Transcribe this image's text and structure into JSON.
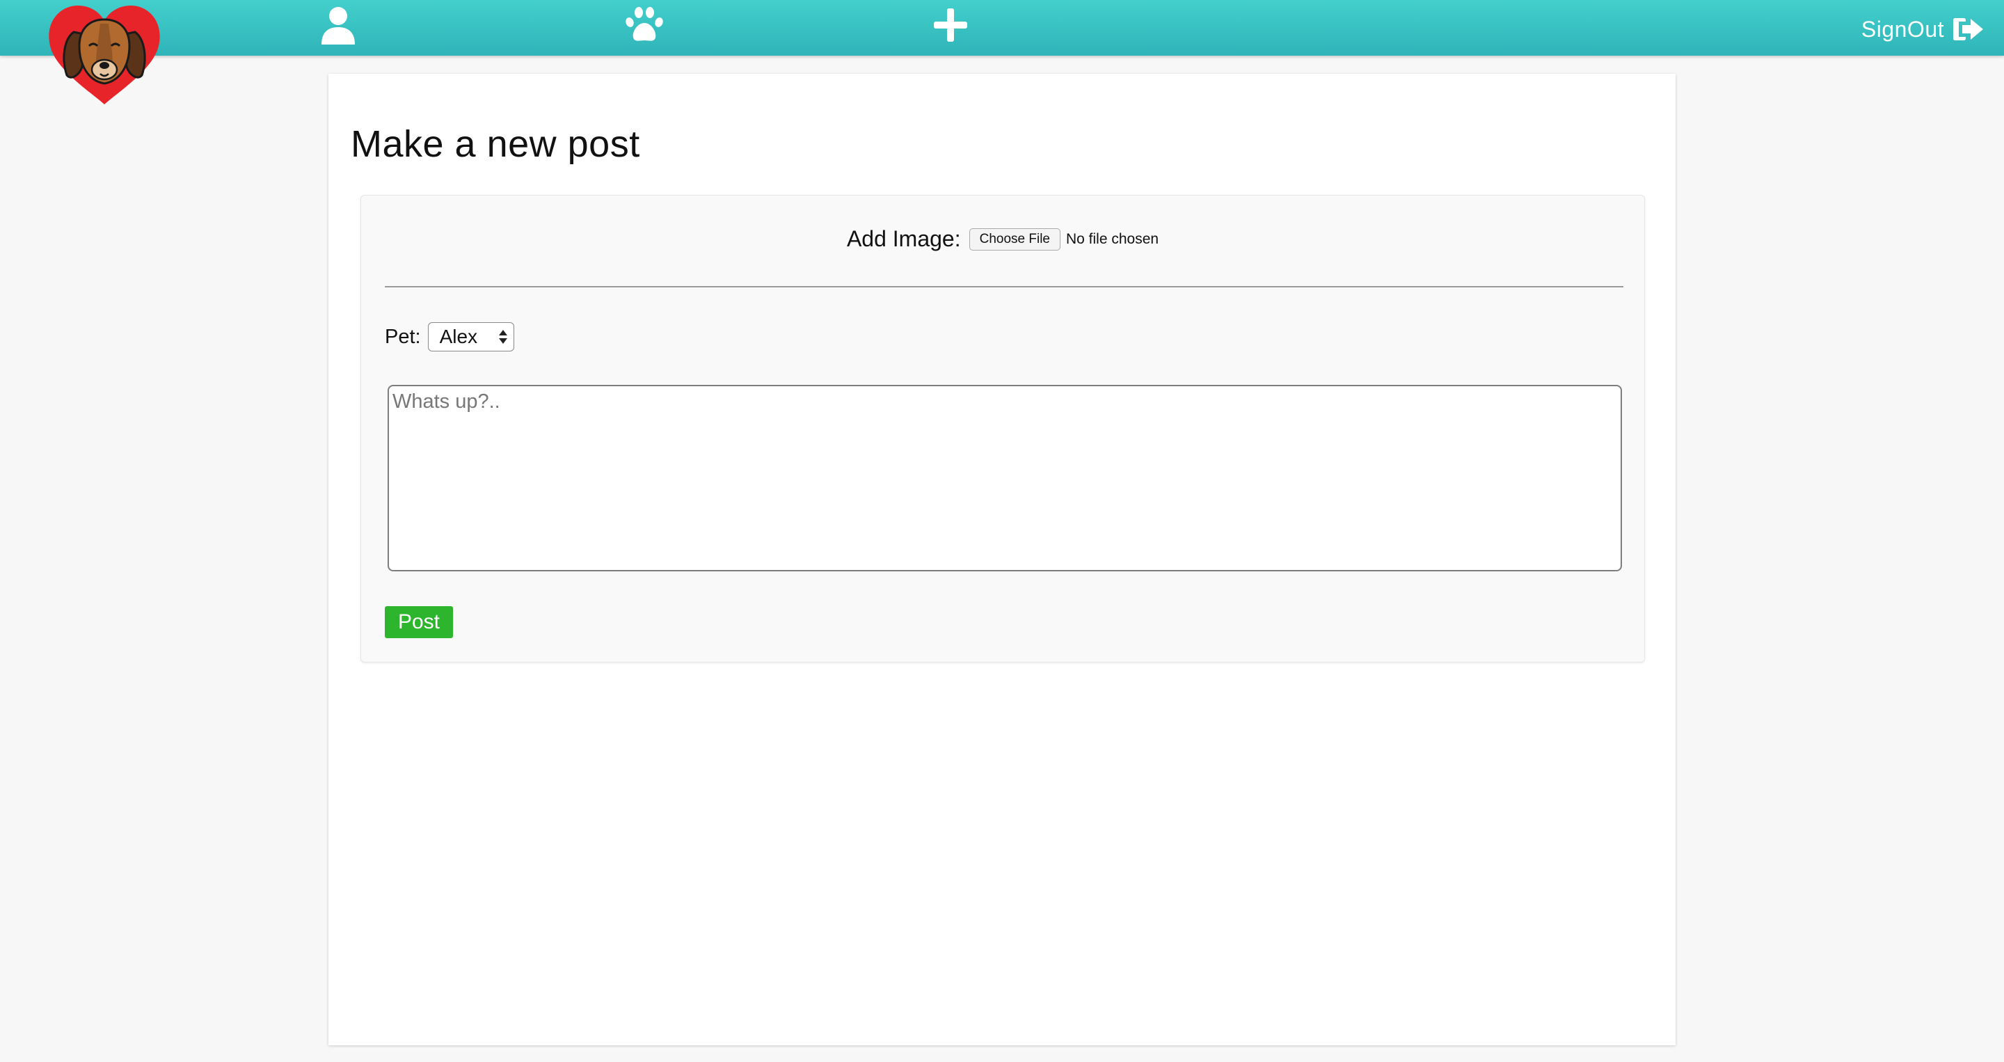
{
  "navbar": {
    "icons": {
      "logo": "dog-heart-logo",
      "profile": "user-icon",
      "pets": "paw-icon",
      "add": "plus-icon",
      "signout": "sign-out-icon"
    },
    "signout_label": "SignOut",
    "colors": {
      "bar_top": "#43cfcc",
      "bar_bottom": "#2fb4b8",
      "logo_heart": "#e8242b"
    }
  },
  "main": {
    "title": "Make a new post",
    "form": {
      "image_label": "Add Image:",
      "choose_file_label": "Choose File",
      "file_status": "No file chosen",
      "pet_label": "Pet:",
      "pet_selected": "Alex",
      "textarea_placeholder": "Whats up?..",
      "textarea_value": "",
      "post_button_label": "Post",
      "post_button_color": "#2db52e"
    }
  }
}
